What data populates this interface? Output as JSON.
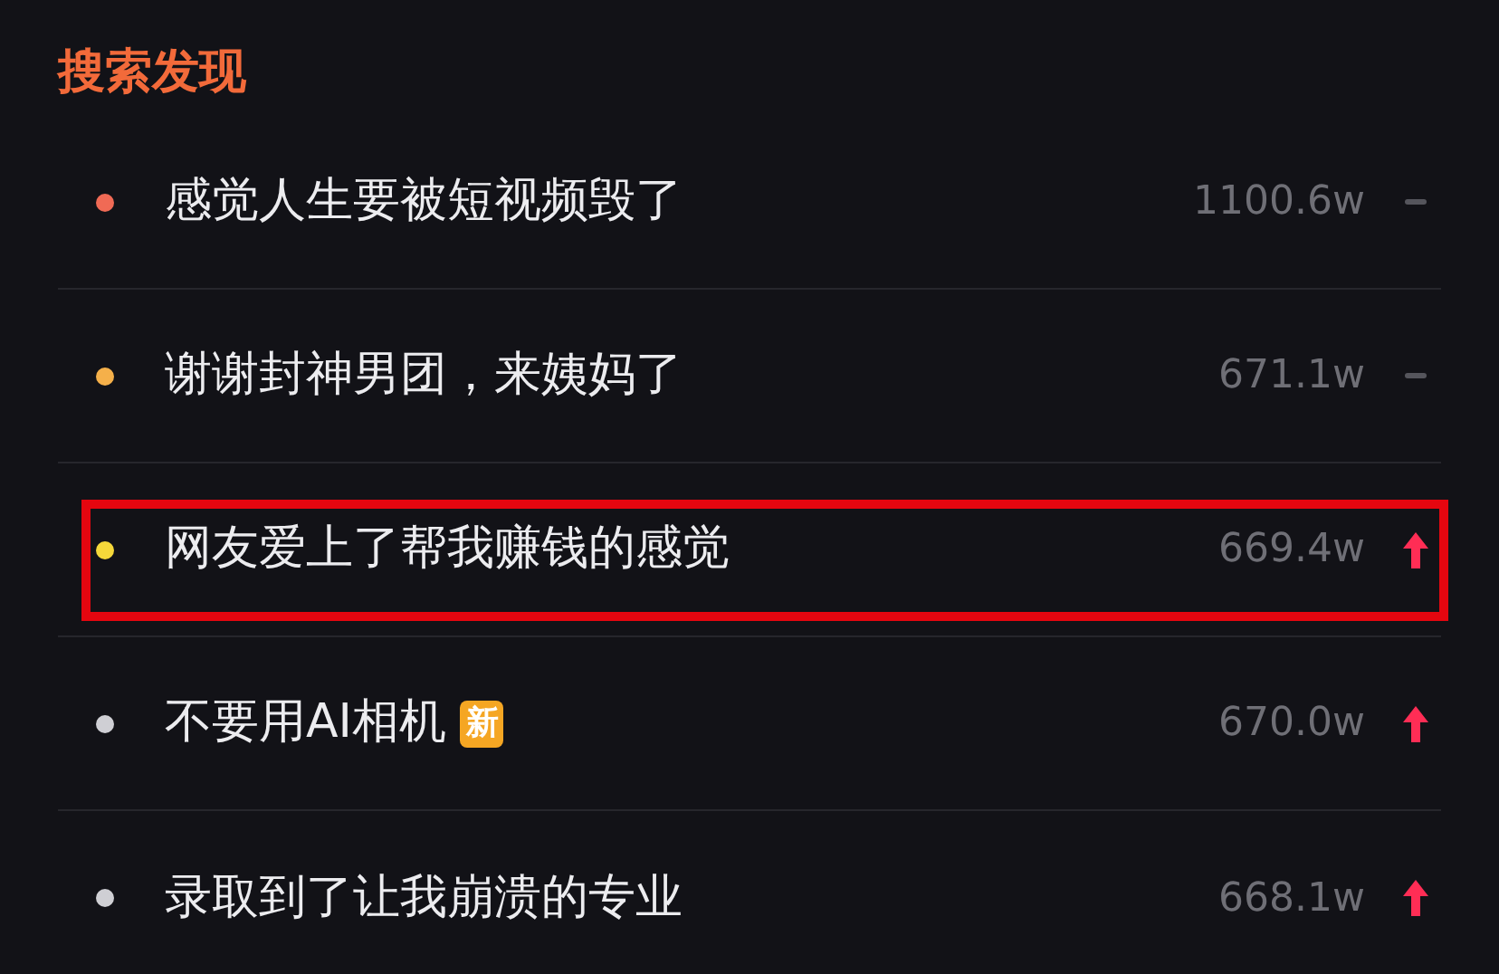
{
  "title": "搜索发现",
  "items": [
    {
      "text": "感觉人生要被短视频毁了",
      "color": "#f06a55",
      "count": "1100.6w",
      "kind": "same",
      "highlighted": false
    },
    {
      "text": "谢谢封神男团，来姨妈了",
      "color": "#f5b04a",
      "count": "671.1w",
      "kind": "same",
      "highlighted": false
    },
    {
      "text": "网友爱上了帮我赚钱的感觉",
      "color": "#f5d83a",
      "count": "669.4w",
      "kind": "up",
      "highlighted": true
    },
    {
      "text": "不要用AI相机",
      "badge": "新",
      "color": "#cfcfd4",
      "count": "670.0w",
      "kind": "up",
      "highlighted": false
    },
    {
      "text": "录取到了让我崩溃的专业",
      "color": "#cfcfd4",
      "count": "668.1w",
      "kind": "up",
      "highlighted": false
    }
  ]
}
